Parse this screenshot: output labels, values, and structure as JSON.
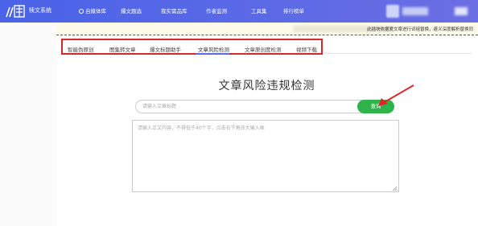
{
  "app": {
    "brand": "犊文系统"
  },
  "nav": {
    "items": [
      {
        "label": "自媒体库",
        "icon": "circle-icon"
      },
      {
        "label": "爆文题选"
      },
      {
        "label": "我实需品库"
      },
      {
        "label": "作者监测"
      },
      {
        "label": "工具集"
      },
      {
        "label": "排行榜单"
      }
    ]
  },
  "notice": {
    "text": "此插块依据爱文章进行词组替换，避义深度解析替换同"
  },
  "tabs": [
    {
      "label": "智能伪原创"
    },
    {
      "label": "图集转文章"
    },
    {
      "label": "爆文标题助手"
    },
    {
      "label": "文章风险检测",
      "active": true
    },
    {
      "label": "文章原创度检测"
    },
    {
      "label": "视频下载"
    }
  ],
  "main": {
    "title": "文章风险违规检测",
    "title_placeholder": "请输入文章标题",
    "query_label": "查询",
    "content_placeholder": "请输入正文内容，不得低于40个字，点击右下角放大输入框"
  },
  "colors": {
    "nav": "#5b69e6",
    "accent_red": "#d8262d",
    "button_green": "#2eb44a"
  }
}
